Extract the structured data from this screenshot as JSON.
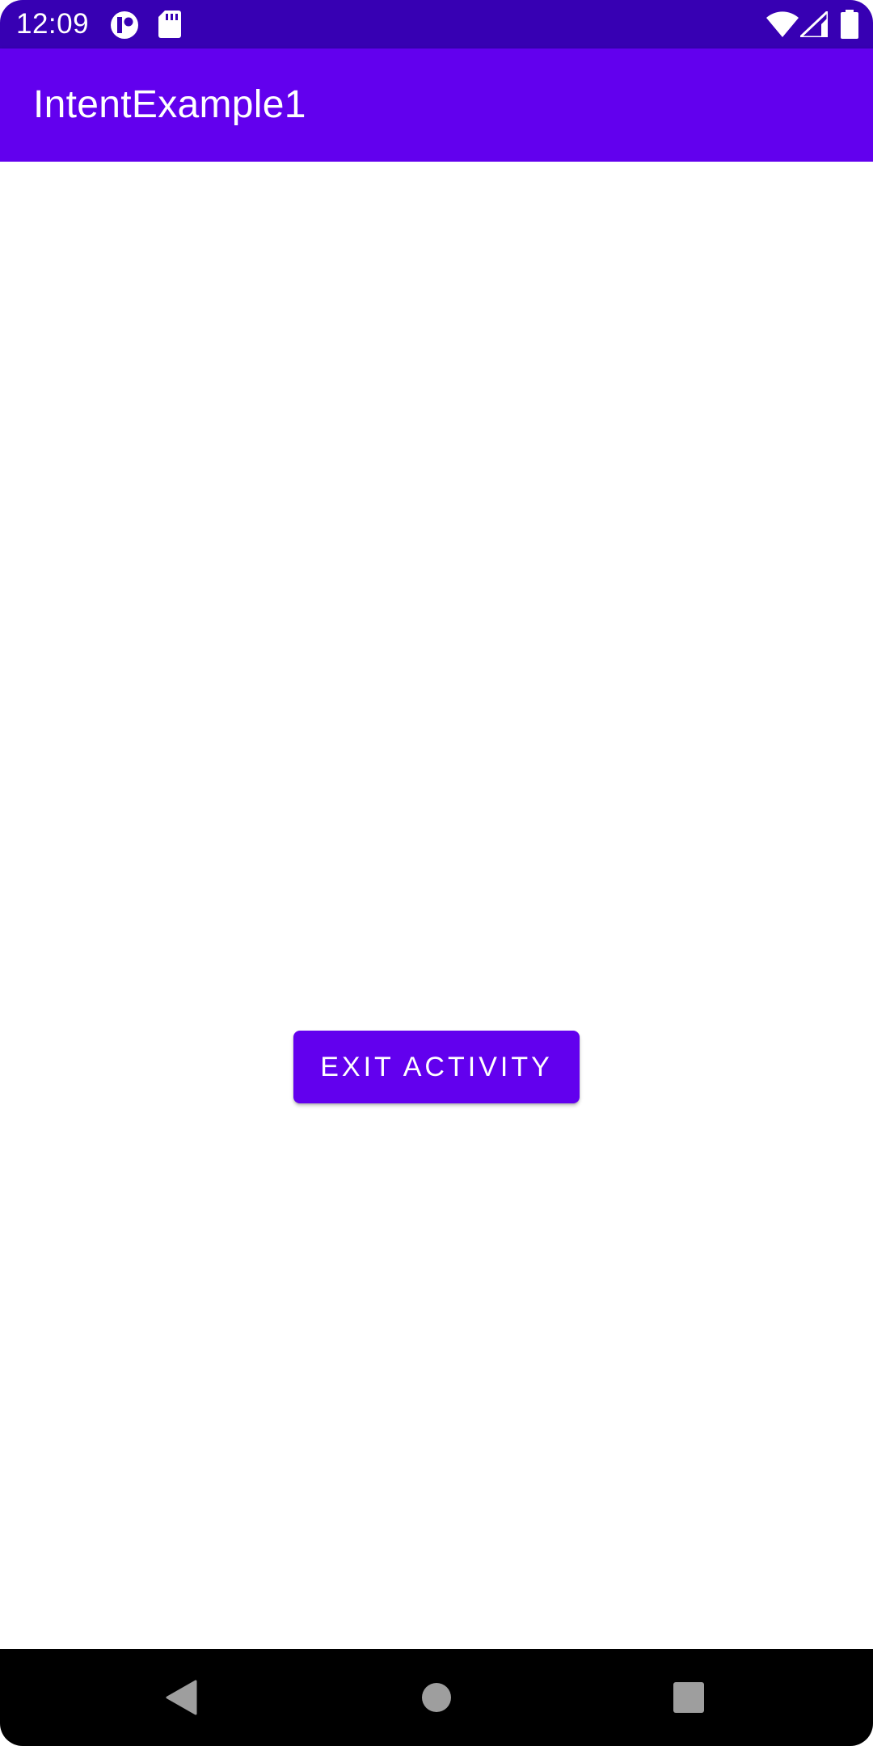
{
  "status_bar": {
    "time": "12:09",
    "left_icons": [
      "data-saver-icon",
      "sd-card-icon"
    ],
    "right_icons": [
      "wifi-icon",
      "signal-icon",
      "battery-icon"
    ],
    "background": "#3700b3"
  },
  "app_bar": {
    "title": "IntentExample1",
    "background": "#6200ee"
  },
  "main": {
    "exit_button_label": "EXIT ACTIVITY",
    "button_color": "#6200ee"
  },
  "nav_bar": {
    "buttons": [
      "back-icon",
      "home-icon",
      "recents-icon"
    ]
  }
}
